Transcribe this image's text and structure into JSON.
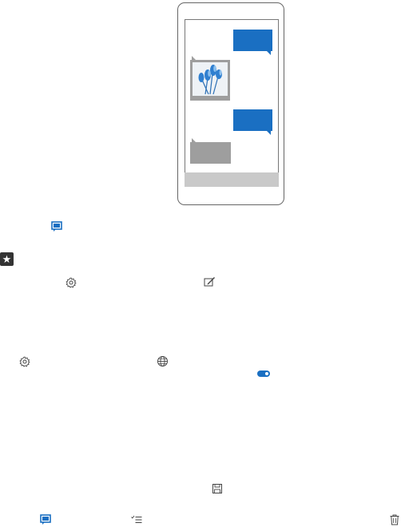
{
  "illustration": {
    "description_visible_text": ""
  },
  "icons": {
    "message": "message-icon",
    "favorite": "star-icon",
    "settings": "gear-icon",
    "compose": "compose-icon",
    "language": "globe-icon",
    "toggle": "toggle-icon",
    "save": "save-icon",
    "select": "select-icon",
    "delete": "trash-icon"
  },
  "colors": {
    "accent": "#1a6fc2",
    "bubble_in": "#9e9e9e",
    "text": "#222222"
  }
}
